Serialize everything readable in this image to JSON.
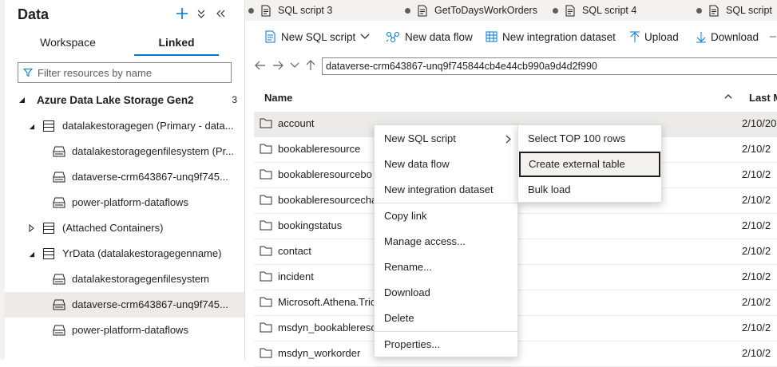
{
  "colors": {
    "accent": "#0078d4",
    "text": "#201f1e",
    "selected_bg": "#edebe9"
  },
  "left_panel": {
    "title": "Data",
    "tabs": [
      {
        "label": "Workspace"
      },
      {
        "label": "Linked"
      }
    ],
    "active_tab": "Linked",
    "filter_placeholder": "Filter resources by name",
    "section": {
      "title": "Azure Data Lake Storage Gen2",
      "count": "3"
    },
    "tree": [
      {
        "label": "datalakestoragegen (Primary - data...",
        "icon": "storage-account-icon",
        "expanded": true
      },
      {
        "label": "datalakestoragegenfilesystem (Pr...",
        "icon": "container-icon"
      },
      {
        "label": "dataverse-crm643867-unq9f745...",
        "icon": "container-icon"
      },
      {
        "label": "power-platform-dataflows",
        "icon": "container-icon"
      },
      {
        "label": "(Attached Containers)",
        "icon": "storage-account-icon",
        "expanded": false
      },
      {
        "label": "YrData (datalakestoragegenname)",
        "icon": "storage-account-icon",
        "expanded": true
      },
      {
        "label": "datalakestoragegenfilesystem",
        "icon": "container-icon"
      },
      {
        "label": "dataverse-crm643867-unq9f745...",
        "icon": "container-icon",
        "selected": true
      },
      {
        "label": "power-platform-dataflows",
        "icon": "container-icon"
      }
    ]
  },
  "doc_tabs": [
    {
      "label": "SQL script 3",
      "icon": "sql-script-icon"
    },
    {
      "label": "GetToDaysWorkOrders",
      "icon": "sql-script-icon"
    },
    {
      "label": "SQL script 4",
      "icon": "sql-script-icon"
    },
    {
      "label": "SQL script",
      "icon": "sql-script-icon"
    }
  ],
  "toolbar": {
    "new_sql_script": "New SQL script",
    "new_data_flow": "New data flow",
    "new_integration_dataset": "New integration dataset",
    "upload": "Upload",
    "download": "Download"
  },
  "path": "dataverse-crm643867-unq9f745844cb4e44cb990a9d4d2f990",
  "columns": {
    "name": "Name",
    "last_modified": "Last M"
  },
  "files": [
    {
      "name": "account",
      "date": "2/10/20"
    },
    {
      "name": "bookableresource",
      "date": "2/10/2"
    },
    {
      "name": "bookableresourcebo",
      "date": "2/10/2"
    },
    {
      "name": "bookableresourcecha",
      "date": "2/10/2"
    },
    {
      "name": "bookingstatus",
      "date": "2/10/2"
    },
    {
      "name": "contact",
      "date": "2/10/2"
    },
    {
      "name": "incident",
      "date": "2/10/2"
    },
    {
      "name": "Microsoft.Athena.Tric",
      "date": "2/10/2"
    },
    {
      "name": "msdyn_bookablereso",
      "date": "2/10/2"
    },
    {
      "name": "msdyn_workorder",
      "date": "2/10/2"
    }
  ],
  "context_menu": {
    "items": [
      "New SQL script",
      "New data flow",
      "New integration dataset",
      "Copy link",
      "Manage access...",
      "Rename...",
      "Download",
      "Delete",
      "Properties..."
    ]
  },
  "submenu": {
    "items": [
      "Select TOP 100 rows",
      "Create external table",
      "Bulk load"
    ],
    "focused": "Create external table"
  }
}
